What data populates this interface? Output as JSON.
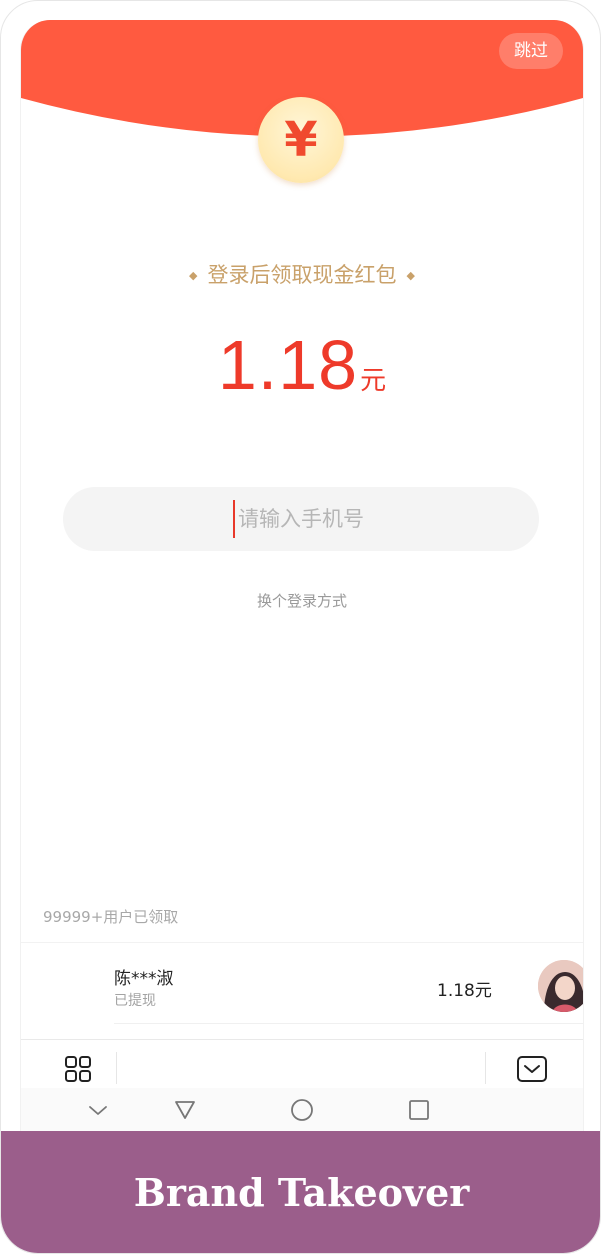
{
  "header": {
    "skip_label": "跳过",
    "coin_symbol": "¥",
    "brand_color": "#ff5a40"
  },
  "promo": {
    "subtitle": "登录后领取现金红包",
    "amount": "1.18",
    "unit": "元",
    "accent_color": "#ee3a2a"
  },
  "login": {
    "phone_placeholder": "请输入手机号",
    "switch_method_label": "换个登录方式"
  },
  "claims": {
    "count_label": "99999+用户已领取",
    "rows": [
      {
        "name": "陈***淑",
        "status": "已提现",
        "amount": "1.18元"
      }
    ]
  },
  "banner": {
    "text": "Brand Takeover",
    "background": "#9b5e8b"
  }
}
